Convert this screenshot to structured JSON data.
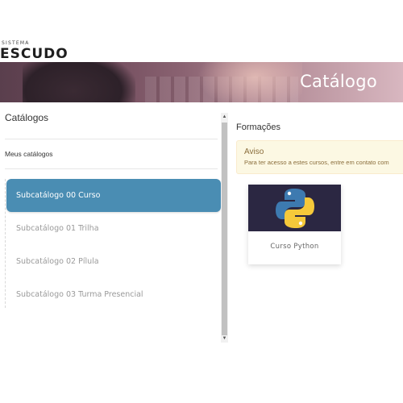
{
  "header": {
    "logo_small": "SISTEMA",
    "logo_big": "ESCUDO"
  },
  "banner": {
    "title": "Catálogo"
  },
  "left_panel": {
    "title": "Catálogos",
    "my_catalogs": "Meus catálogos",
    "items": [
      {
        "label": "Subcatálogo 00 Curso",
        "active": true
      },
      {
        "label": "Subcatálogo 01 Trilha",
        "active": false
      },
      {
        "label": "Subcatálogo 02 Pílula",
        "active": false
      },
      {
        "label": "Subcatálogo 03 Turma Presencial",
        "active": false
      }
    ]
  },
  "scrollbar": {
    "up_icon": "▲",
    "down_icon": "▼"
  },
  "right_panel": {
    "title": "Formações",
    "alert": {
      "title": "Aviso",
      "text": "Para ter acesso a estes cursos, entre em contato com"
    },
    "courses": [
      {
        "name": "Curso Python",
        "icon": "python-logo-icon"
      }
    ]
  },
  "colors": {
    "active_item": "#4a8db3",
    "alert_bg": "#fcf8e3",
    "alert_text": "#8a6d3b",
    "course_thumb_bg": "#2b2742"
  }
}
